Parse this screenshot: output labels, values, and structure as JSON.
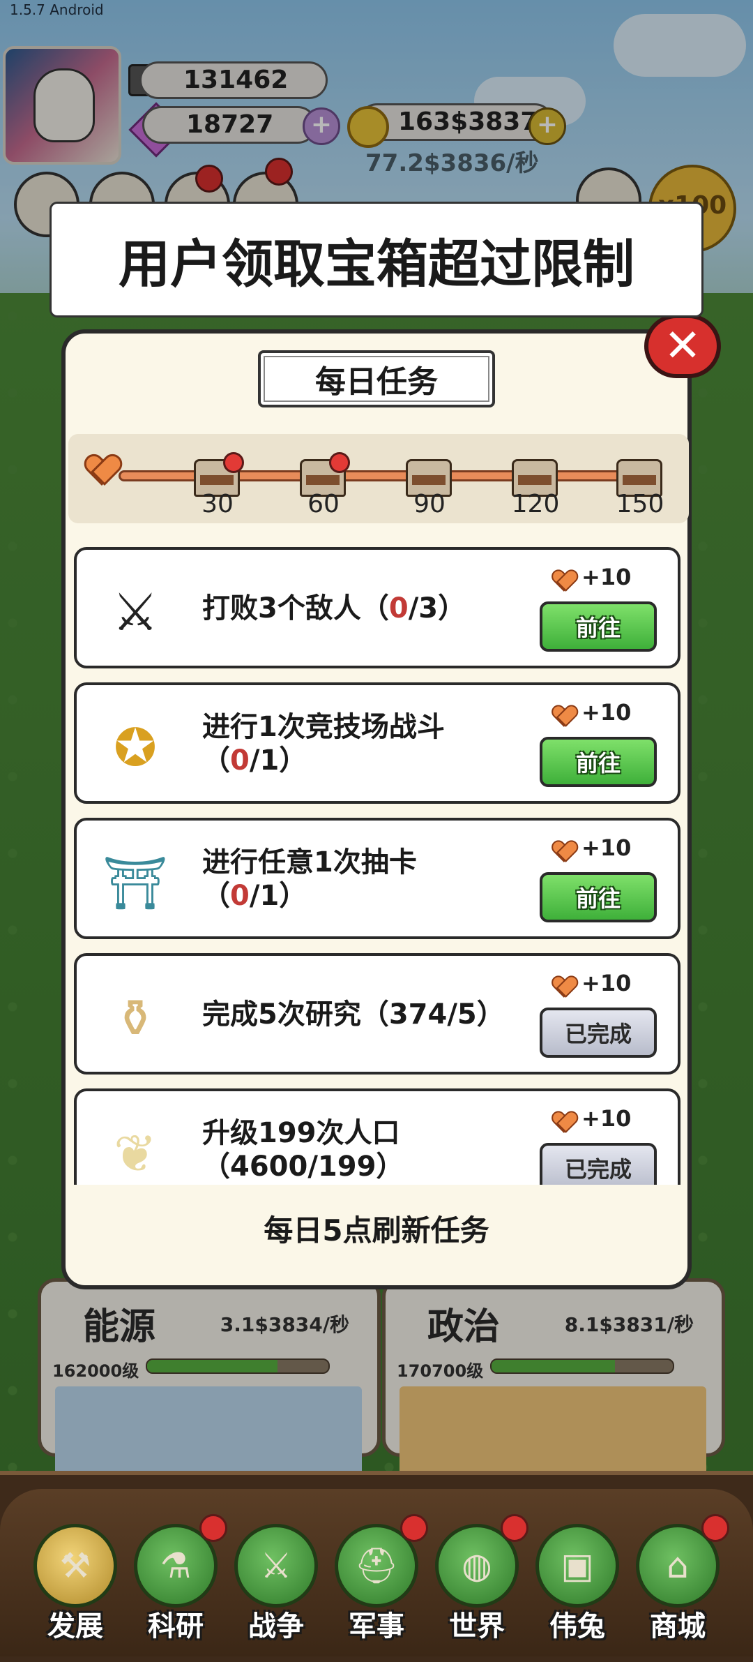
{
  "app": {
    "version": "1.5.7 Android"
  },
  "toast": {
    "message": "用户领取宝箱超过限制"
  },
  "resources": {
    "iron": "131462",
    "gems": "18727",
    "coins": "163$3837",
    "coin_rate": "77.2$3836/秒"
  },
  "badges": {
    "x100": "x100"
  },
  "modal": {
    "title": "每日任务",
    "progress": {
      "milestones": [
        "30",
        "60",
        "90",
        "120",
        "150"
      ],
      "current_fraction": 0
    },
    "tasks": [
      {
        "icon": "crossed-swords-icon",
        "text": "打败3个敌人（",
        "cur": "0",
        "total": "/3）",
        "reward": "+10",
        "button": "前往",
        "status": "go"
      },
      {
        "icon": "medal-icon",
        "text": "进行1次竞技场战斗",
        "text2": "（",
        "cur": "0",
        "total": "/1）",
        "reward": "+10",
        "button": "前往",
        "status": "go"
      },
      {
        "icon": "cauldron-icon",
        "text": "进行任意1次抽卡",
        "text2": "（",
        "cur": "0",
        "total": "/1）",
        "reward": "+10",
        "button": "前往",
        "status": "go"
      },
      {
        "icon": "vase-icon",
        "text": "完成5次研究（374/5）",
        "reward": "+10",
        "button": "已完成",
        "status": "done"
      },
      {
        "icon": "rabbits-icon",
        "text": "升级199次人口",
        "text2": "（4600/199）",
        "reward": "+10",
        "button": "已完成",
        "status": "done"
      }
    ],
    "footer": "每日5点刷新任务"
  },
  "cards": [
    {
      "title": "能源",
      "rate": "3.1$3834/秒",
      "level": "162000级",
      "progress": 0.72
    },
    {
      "title": "政治",
      "rate": "8.1$3831/秒",
      "level": "170700级",
      "progress": 0.68
    }
  ],
  "nav": [
    {
      "label": "发展",
      "icon": "hammer-icon"
    },
    {
      "label": "科研",
      "icon": "flask-icon"
    },
    {
      "label": "战争",
      "icon": "swords-icon"
    },
    {
      "label": "军事",
      "icon": "helmet-icon"
    },
    {
      "label": "世界",
      "icon": "globe-icon"
    },
    {
      "label": "伟兔",
      "icon": "portrait-icon"
    },
    {
      "label": "商城",
      "icon": "shop-icon"
    }
  ]
}
